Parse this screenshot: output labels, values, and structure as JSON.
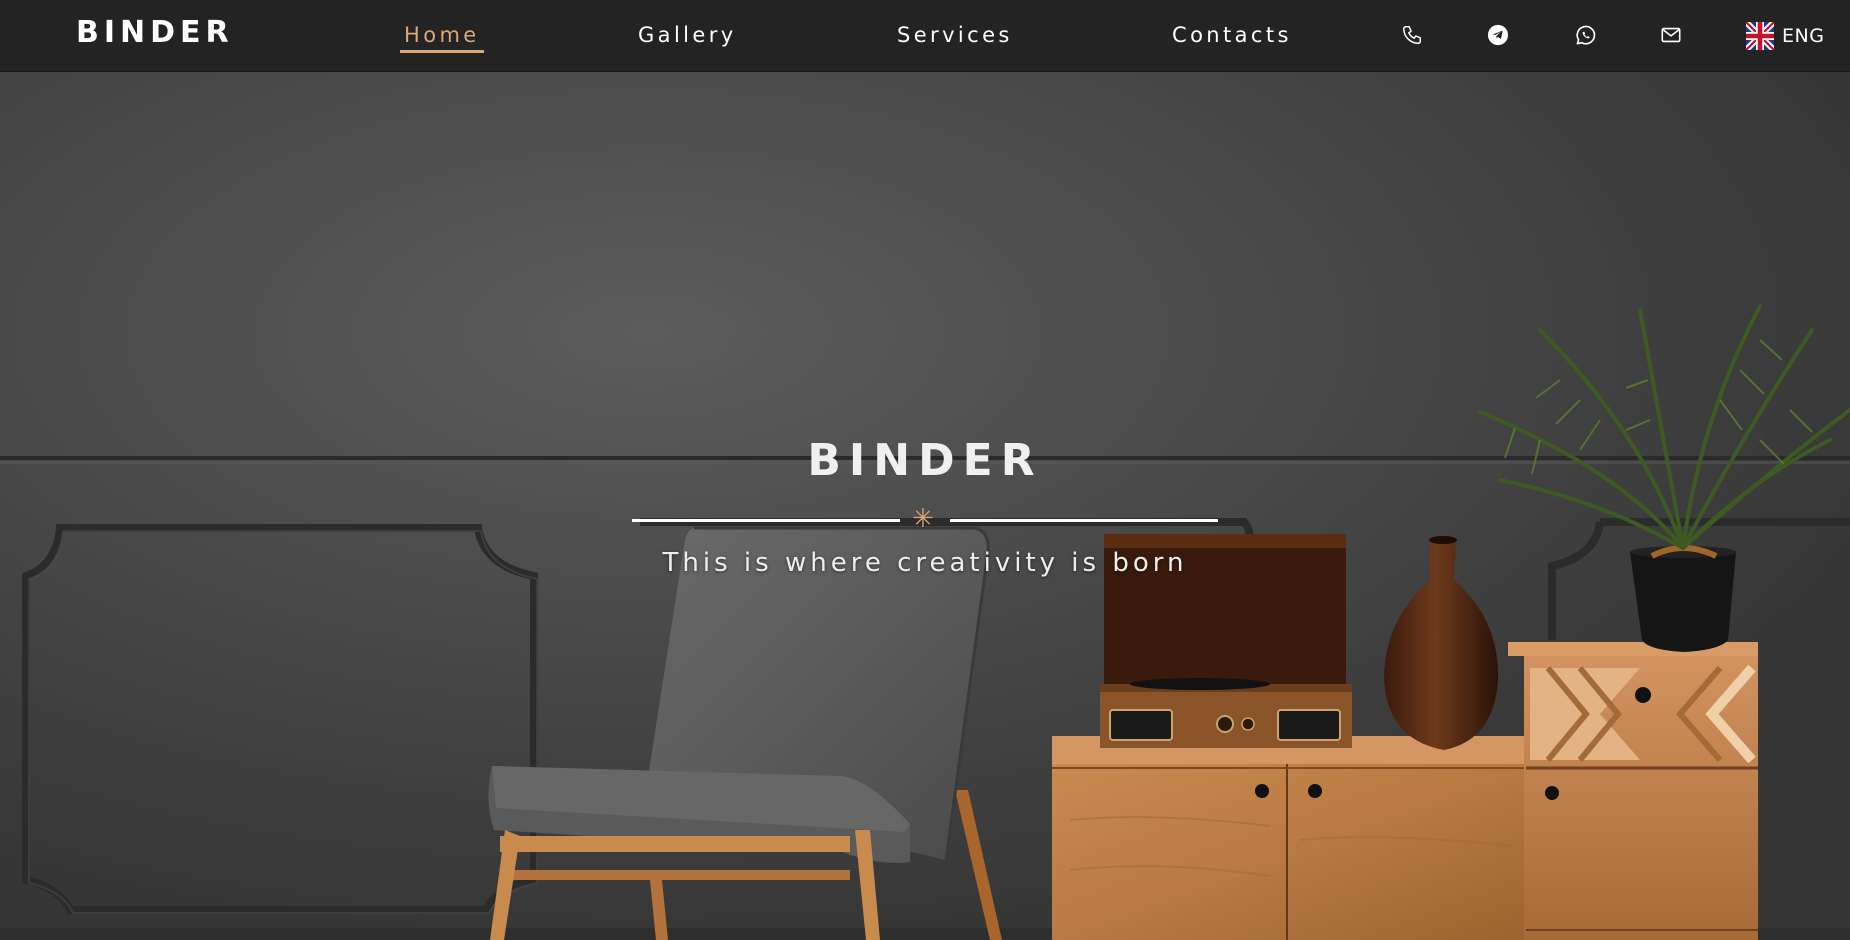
{
  "brand": {
    "logo": "BINDER"
  },
  "nav": {
    "links": [
      {
        "label": "Home",
        "active": true
      },
      {
        "label": "Gallery",
        "active": false
      },
      {
        "label": "Services",
        "active": false
      },
      {
        "label": "Contacts",
        "active": false
      }
    ],
    "icons": [
      "phone-icon",
      "telegram-icon",
      "whatsapp-icon",
      "mail-icon"
    ],
    "language": {
      "label": "ENG",
      "flag": "uk-flag-icon"
    }
  },
  "hero": {
    "title": "BINDER",
    "tagline": "This is where creativity is born",
    "divider_symbol": "✳"
  },
  "colors": {
    "accent": "#d9a877",
    "navbar": "#232323",
    "text": "#ffffff",
    "wall": "#4a4a4a"
  }
}
